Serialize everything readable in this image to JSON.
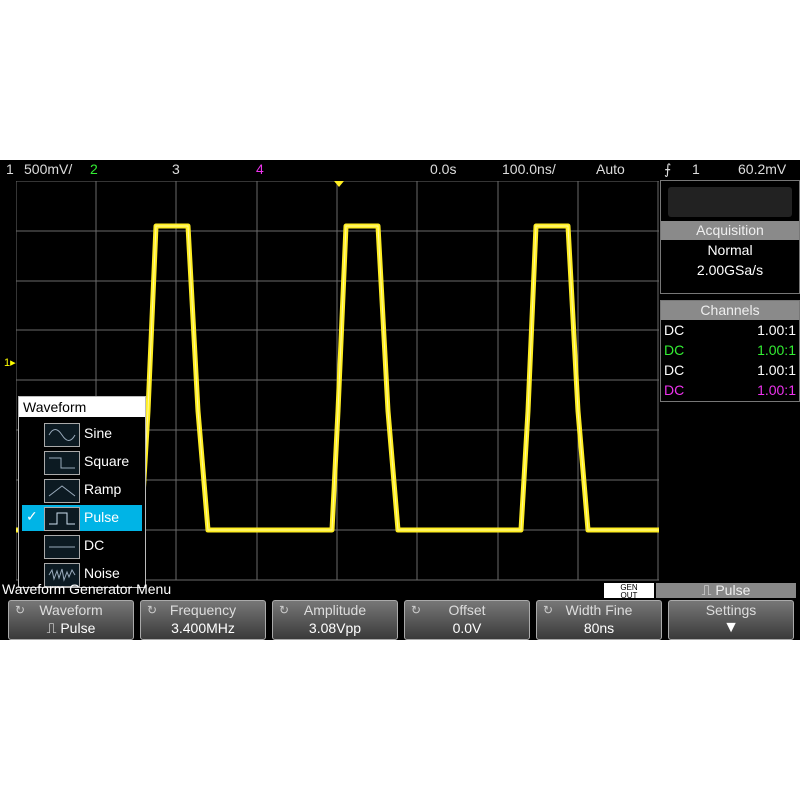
{
  "status_bar": {
    "ch1_num": "1",
    "ch1_scale": "500mV/",
    "ch2_num": "2",
    "ch3_num": "3",
    "ch4_num": "4",
    "delay": "0.0s",
    "timebase": "100.0ns/",
    "trigger_mode": "Auto",
    "trigger_source": "1",
    "trigger_level": "60.2mV"
  },
  "acquisition": {
    "title": "Acquisition",
    "mode": "Normal",
    "rate": "2.00GSa/s"
  },
  "channels": {
    "title": "Channels",
    "rows": [
      {
        "coupling": "DC",
        "ratio": "1.00:1",
        "color": "#ffffff"
      },
      {
        "coupling": "DC",
        "ratio": "1.00:1",
        "color": "#33ee33"
      },
      {
        "coupling": "DC",
        "ratio": "1.00:1",
        "color": "#ffffff"
      },
      {
        "coupling": "DC",
        "ratio": "1.00:1",
        "color": "#ee33ee"
      }
    ]
  },
  "waveform_menu": {
    "title": "Waveform",
    "items": [
      {
        "label": "Sine",
        "icon": "sine-wave-icon",
        "selected": false
      },
      {
        "label": "Square",
        "icon": "square-wave-icon",
        "selected": false
      },
      {
        "label": "Ramp",
        "icon": "ramp-wave-icon",
        "selected": false
      },
      {
        "label": "Pulse",
        "icon": "pulse-wave-icon",
        "selected": true
      },
      {
        "label": "DC",
        "icon": "dc-line-icon",
        "selected": false
      },
      {
        "label": "Noise",
        "icon": "noise-wave-icon",
        "selected": false
      }
    ],
    "check": "✓"
  },
  "bottom": {
    "menu_title": "Waveform Generator Menu",
    "gen_out_top": "GEN",
    "gen_out_bottom": "OUT",
    "active_waveform": "Pulse"
  },
  "softkeys": [
    {
      "label": "Waveform",
      "value": "Pulse"
    },
    {
      "label": "Frequency",
      "value": "3.400MHz"
    },
    {
      "label": "Amplitude",
      "value": "3.08Vpp"
    },
    {
      "label": "Offset",
      "value": "0.0V"
    },
    {
      "label": "Width Fine",
      "value": "80ns"
    },
    {
      "label": "Settings",
      "value": ""
    }
  ],
  "colors": {
    "trace": "#ffee22",
    "grid": "#6a6a6a",
    "highlight": "#00b4e6"
  },
  "icons": [
    "trigger-edge-icon",
    "rotate-knob-icon",
    "down-arrow-icon",
    "ground-marker-icon"
  ]
}
